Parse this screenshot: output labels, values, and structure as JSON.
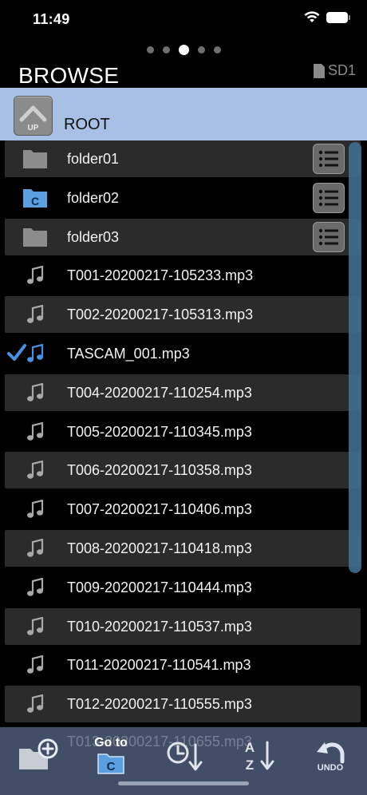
{
  "status": {
    "time": "11:49"
  },
  "pager": {
    "count": 5,
    "active_index": 2
  },
  "header": {
    "title": "BROWSE",
    "storage": "SD1"
  },
  "root_bar": {
    "up_label": "UP",
    "path": "ROOT"
  },
  "files": [
    {
      "name": "folder01",
      "type": "folder",
      "shaded": true,
      "menu": true,
      "checked": false
    },
    {
      "name": "folder02",
      "type": "folder-current",
      "shaded": false,
      "menu": true,
      "checked": false
    },
    {
      "name": "folder03",
      "type": "folder",
      "shaded": true,
      "menu": true,
      "checked": false
    },
    {
      "name": "T001-20200217-105233.mp3",
      "type": "audio",
      "shaded": false,
      "menu": false,
      "checked": false
    },
    {
      "name": "T002-20200217-105313.mp3",
      "type": "audio",
      "shaded": true,
      "menu": false,
      "checked": false
    },
    {
      "name": "TASCAM_001.mp3",
      "type": "audio",
      "shaded": false,
      "menu": false,
      "checked": true
    },
    {
      "name": "T004-20200217-110254.mp3",
      "type": "audio",
      "shaded": true,
      "menu": false,
      "checked": false
    },
    {
      "name": "T005-20200217-110345.mp3",
      "type": "audio",
      "shaded": false,
      "menu": false,
      "checked": false
    },
    {
      "name": "T006-20200217-110358.mp3",
      "type": "audio",
      "shaded": true,
      "menu": false,
      "checked": false
    },
    {
      "name": "T007-20200217-110406.mp3",
      "type": "audio",
      "shaded": false,
      "menu": false,
      "checked": false
    },
    {
      "name": "T008-20200217-110418.mp3",
      "type": "audio",
      "shaded": true,
      "menu": false,
      "checked": false
    },
    {
      "name": "T009-20200217-110444.mp3",
      "type": "audio",
      "shaded": false,
      "menu": false,
      "checked": false
    },
    {
      "name": "T010-20200217-110537.mp3",
      "type": "audio",
      "shaded": true,
      "menu": false,
      "checked": false
    },
    {
      "name": "T011-20200217-110541.mp3",
      "type": "audio",
      "shaded": false,
      "menu": false,
      "checked": false
    },
    {
      "name": "T012-20200217-110555.mp3",
      "type": "audio",
      "shaded": true,
      "menu": false,
      "checked": false
    }
  ],
  "toolbar": {
    "partial_row": "T013-20200217-110655.mp3",
    "goto_label": "Go to",
    "goto_folder_letter": "C",
    "sort_alpha_top": "A",
    "sort_alpha_bottom": "Z",
    "undo_label": "UNDO"
  },
  "colors": {
    "accent": "#4a90e2",
    "root_bar": "#a8bfe6",
    "toolbar": "#414e66",
    "row_shade": "#2b2b2b",
    "scrollbar": "#3e6f8e"
  }
}
